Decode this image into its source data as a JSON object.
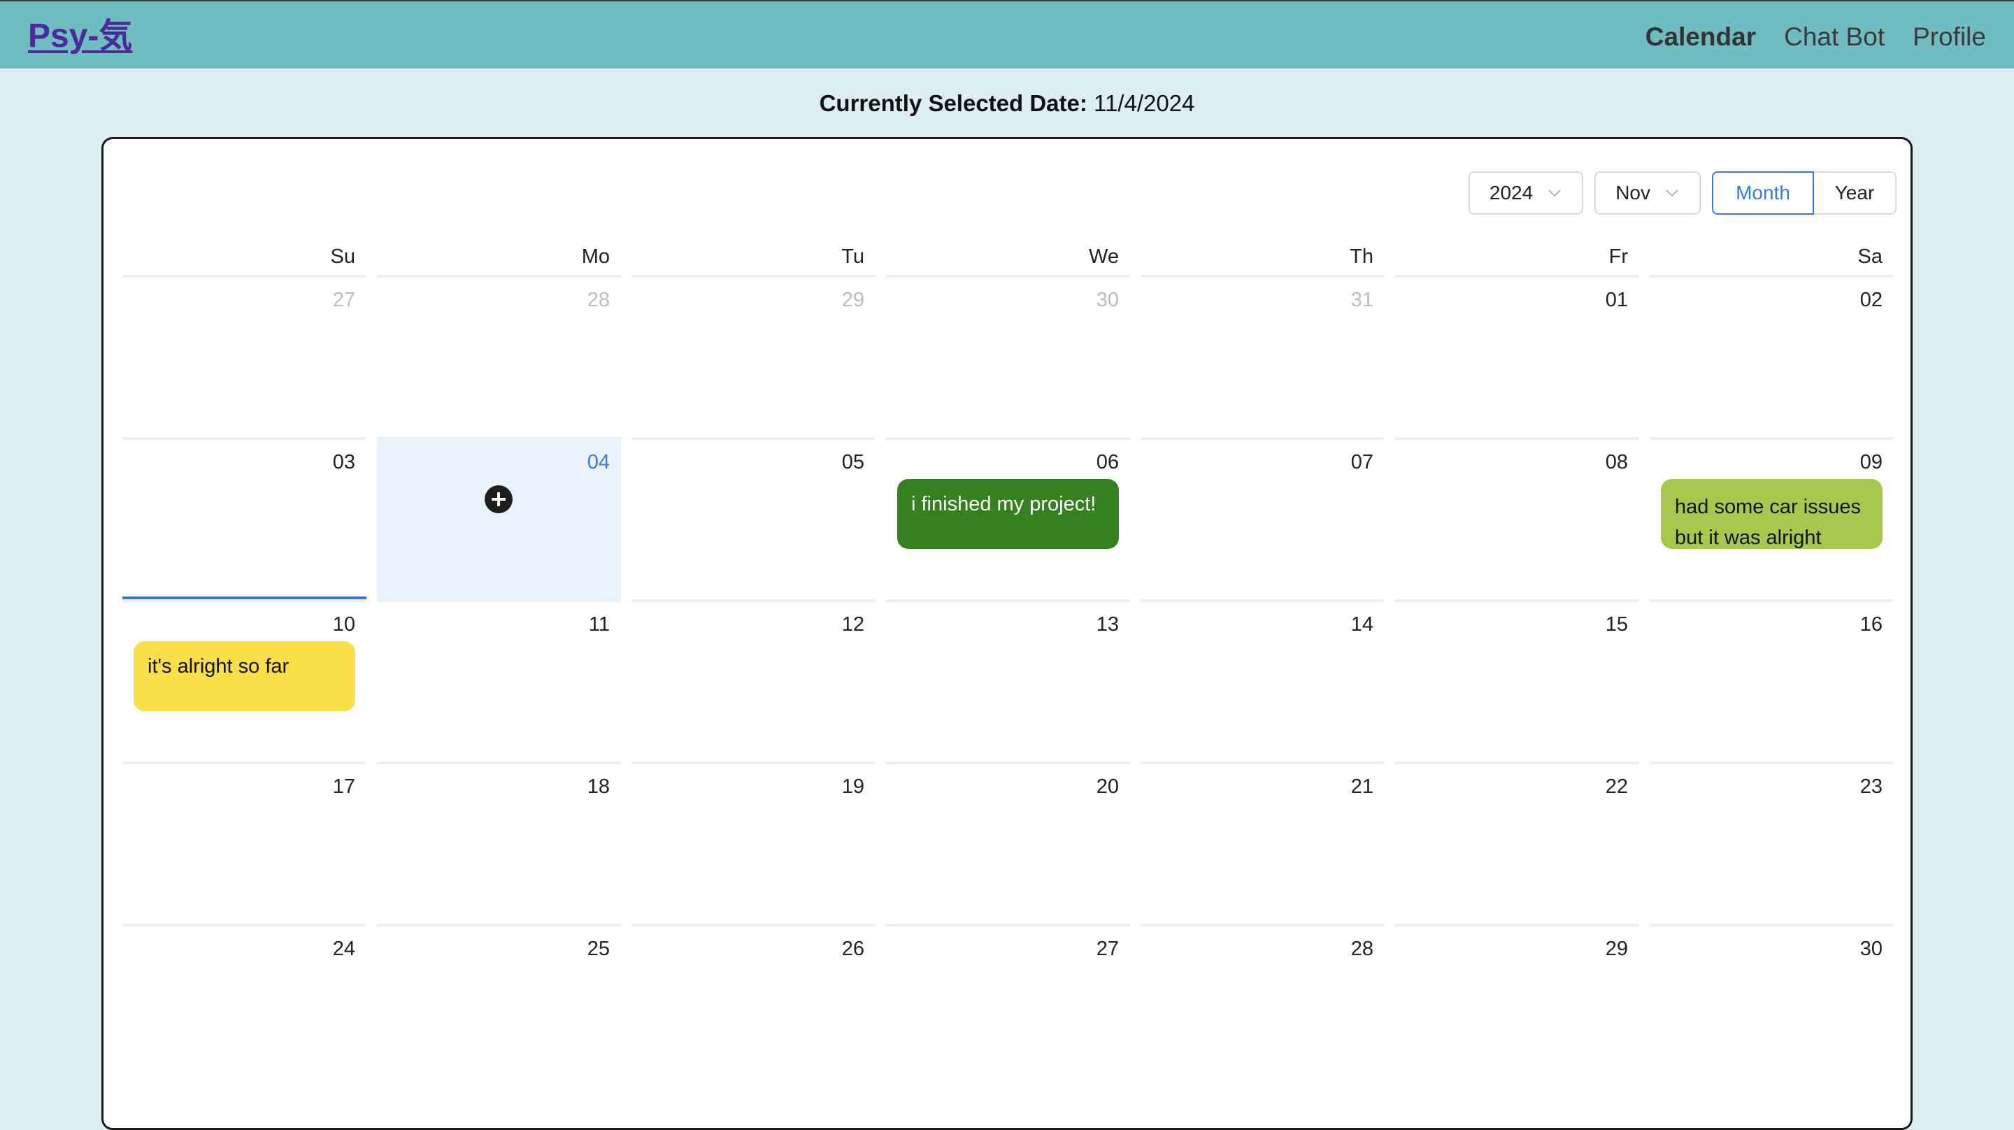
{
  "nav": {
    "brand": "Psy-気",
    "links": [
      {
        "label": "Calendar",
        "active": true
      },
      {
        "label": "Chat Bot",
        "active": false
      },
      {
        "label": "Profile",
        "active": false
      }
    ]
  },
  "selected": {
    "label": "Currently Selected Date:",
    "value": "11/4/2024"
  },
  "controls": {
    "year": "2024",
    "month": "Nov",
    "mode_month": "Month",
    "mode_year": "Year",
    "active_mode": "Month"
  },
  "weekdays": [
    "Su",
    "Mo",
    "Tu",
    "We",
    "Th",
    "Fr",
    "Sa"
  ],
  "weeks": [
    [
      {
        "day": "27",
        "muted": true
      },
      {
        "day": "28",
        "muted": true
      },
      {
        "day": "29",
        "muted": true
      },
      {
        "day": "30",
        "muted": true
      },
      {
        "day": "31",
        "muted": true
      },
      {
        "day": "01"
      },
      {
        "day": "02"
      }
    ],
    [
      {
        "day": "03",
        "underline": true
      },
      {
        "day": "04",
        "today": true,
        "add_icon": "plus-circle-icon"
      },
      {
        "day": "05"
      },
      {
        "day": "06",
        "event": "i finished my project!",
        "event_color": "#36811f",
        "event_class": "green-dark"
      },
      {
        "day": "07"
      },
      {
        "day": "08"
      },
      {
        "day": "09",
        "event": "had some car issues but it was alright",
        "event_color": "#a6c94d",
        "event_class": "green-light"
      }
    ],
    [
      {
        "day": "10",
        "event": "it's alright so far",
        "event_color": "#f9df4a",
        "event_class": "yellow"
      },
      {
        "day": "11"
      },
      {
        "day": "12"
      },
      {
        "day": "13"
      },
      {
        "day": "14"
      },
      {
        "day": "15"
      },
      {
        "day": "16"
      }
    ],
    [
      {
        "day": "17"
      },
      {
        "day": "18"
      },
      {
        "day": "19"
      },
      {
        "day": "20"
      },
      {
        "day": "21"
      },
      {
        "day": "22"
      },
      {
        "day": "23"
      }
    ],
    [
      {
        "day": "24"
      },
      {
        "day": "25"
      },
      {
        "day": "26"
      },
      {
        "day": "27"
      },
      {
        "day": "28"
      },
      {
        "day": "29"
      },
      {
        "day": "30"
      }
    ]
  ],
  "colors": {
    "navbar": "#70bdc1",
    "page_bg": "#dcedf4",
    "accent": "#3b78e7",
    "today_bg": "#e8f3fd",
    "brand": "#4b2a9b"
  }
}
